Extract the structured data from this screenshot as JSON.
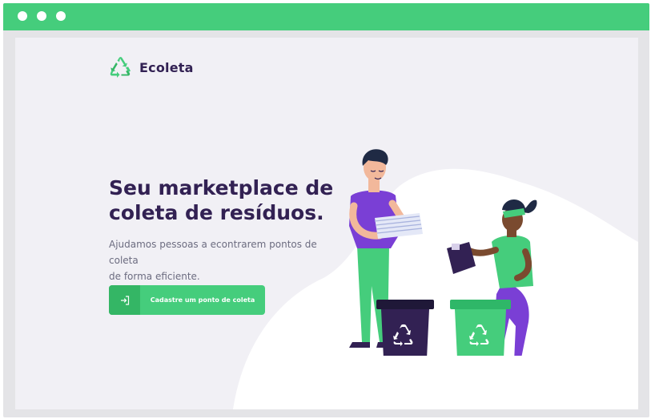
{
  "window": {
    "titlebar_color": "#45cd7c",
    "controls": [
      "window-dot",
      "window-dot",
      "window-dot"
    ]
  },
  "brand": {
    "name": "Ecoleta",
    "icon": "recycle-icon",
    "color": "#45cd7c"
  },
  "hero": {
    "title_line1": "Seu marketplace de",
    "title_line2": "coleta de resíduos.",
    "description_line1": "Ajudamos pessoas a econtrarem pontos de coleta",
    "description_line2": "de forma eficiente.",
    "title_color": "#322153",
    "text_color": "#6c6c80"
  },
  "cta": {
    "label": "Cadastre um ponto de coleta",
    "icon": "sign-in-icon"
  },
  "illustration": {
    "description_icons": [
      "recycle-bin-icon",
      "recycle-bin-icon"
    ],
    "bin_colors": [
      "#322153",
      "#45cd7c"
    ]
  }
}
